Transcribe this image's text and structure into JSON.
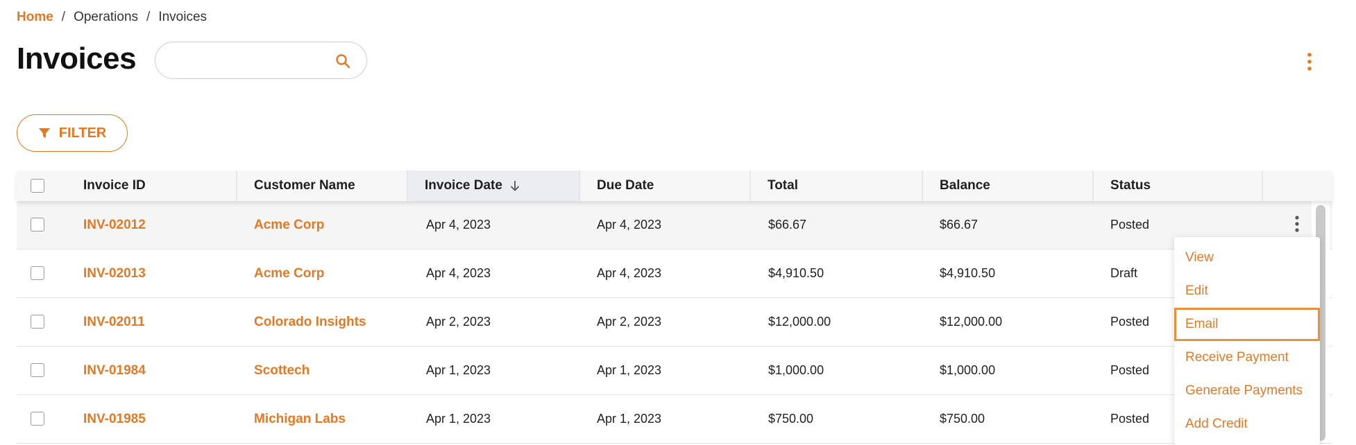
{
  "breadcrumb": {
    "home": "Home",
    "section": "Operations",
    "current": "Invoices",
    "separator": "/"
  },
  "page": {
    "title": "Invoices"
  },
  "search": {
    "placeholder": "",
    "value": "",
    "icon": "search-icon"
  },
  "toolbar": {
    "filter_label": "FILTER",
    "filter_icon": "filter-icon",
    "more_icon": "more-vert-icon"
  },
  "colors": {
    "accent": "#e07a26",
    "focus_border": "#e9903a",
    "header_bg": "#f7f7f8",
    "sorted_header_bg": "#ececf3",
    "hover_row_bg": "#f5f5f5"
  },
  "table": {
    "sort": {
      "column": "Invoice Date",
      "direction": "descending"
    },
    "columns": [
      "Invoice ID",
      "Customer Name",
      "Invoice Date",
      "Due Date",
      "Total",
      "Balance",
      "Status"
    ],
    "rows": [
      {
        "id": "INV-02012",
        "customer": "Acme Corp",
        "invoice_date": "Apr 4, 2023",
        "due_date": "Apr 4, 2023",
        "total": "$66.67",
        "balance": "$66.67",
        "status": "Posted"
      },
      {
        "id": "INV-02013",
        "customer": "Acme Corp",
        "invoice_date": "Apr 4, 2023",
        "due_date": "Apr 4, 2023",
        "total": "$4,910.50",
        "balance": "$4,910.50",
        "status": "Draft"
      },
      {
        "id": "INV-02011",
        "customer": "Colorado Insights",
        "invoice_date": "Apr 2, 2023",
        "due_date": "Apr 2, 2023",
        "total": "$12,000.00",
        "balance": "$12,000.00",
        "status": "Posted"
      },
      {
        "id": "INV-01984",
        "customer": "Scottech",
        "invoice_date": "Apr 1, 2023",
        "due_date": "Apr 1, 2023",
        "total": "$1,000.00",
        "balance": "$1,000.00",
        "status": "Posted"
      },
      {
        "id": "INV-01985",
        "customer": "Michigan Labs",
        "invoice_date": "Apr 1, 2023",
        "due_date": "Apr 1, 2023",
        "total": "$750.00",
        "balance": "$750.00",
        "status": "Posted"
      }
    ]
  },
  "row_menu": {
    "items": [
      "View",
      "Edit",
      "Email",
      "Receive Payment",
      "Generate Payments",
      "Add Credit"
    ],
    "focused": "Email"
  }
}
